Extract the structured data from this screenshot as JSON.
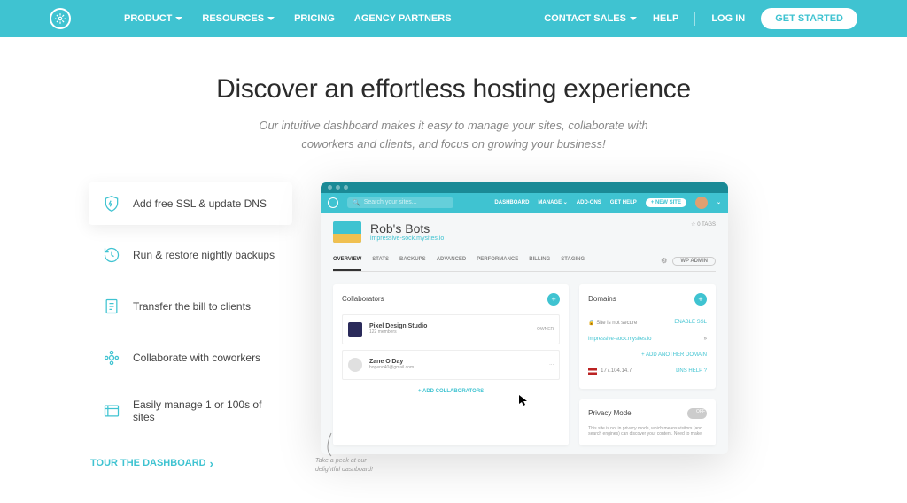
{
  "nav": {
    "left": [
      "PRODUCT",
      "RESOURCES",
      "PRICING",
      "AGENCY PARTNERS"
    ],
    "contact": "CONTACT SALES",
    "help": "HELP",
    "login": "LOG IN",
    "cta": "GET STARTED"
  },
  "hero": {
    "title": "Discover an effortless hosting experience",
    "subtitle": "Our intuitive dashboard makes it easy to manage your sites, collaborate with coworkers and clients, and focus on growing your business!"
  },
  "features": [
    "Add free SSL & update DNS",
    "Run & restore nightly backups",
    "Transfer the bill to clients",
    "Collaborate with coworkers",
    "Easily manage 1 or 100s of sites"
  ],
  "tour": "TOUR THE DASHBOARD",
  "dash": {
    "search_ph": "Search your sites...",
    "nav": [
      "DASHBOARD",
      "MANAGE",
      "ADD-ONS",
      "GET HELP"
    ],
    "newsite": "+ NEW SITE",
    "site_name": "Rob's Bots",
    "site_url": "impressive-sock.mysites.io",
    "tags": "☆ 0 TAGS",
    "tabs": [
      "OVERVIEW",
      "STATS",
      "BACKUPS",
      "ADVANCED",
      "PERFORMANCE",
      "BILLING",
      "STAGING"
    ],
    "wpadmin": "WP ADMIN",
    "collab_h": "Collaborators",
    "collab1_t": "Pixel Design Studio",
    "collab1_s": "122 members",
    "collab1_r": "OWNER",
    "collab2_t": "Zane O'Day",
    "collab2_s": "hopeno40@gmail.com",
    "collab2_r": "···",
    "addcollab": "+ ADD COLLABORATORS",
    "domains_h": "Domains",
    "d1l": "🔒 Site is not secure",
    "d1r": "ENABLE SSL",
    "d2l": "impressive-sock.mysites.io",
    "d2r": "»",
    "addanother": "+ ADD ANOTHER DOMAIN",
    "d3l": "177.104.14.7",
    "d3r": "DNS HELP ?",
    "privacy_h": "Privacy Mode",
    "privacy_t": "This site is not in privacy mode, which means visitors (and search engines) can discover your content. Need to make"
  },
  "note": "Take a peek at our delightful dashboard!"
}
